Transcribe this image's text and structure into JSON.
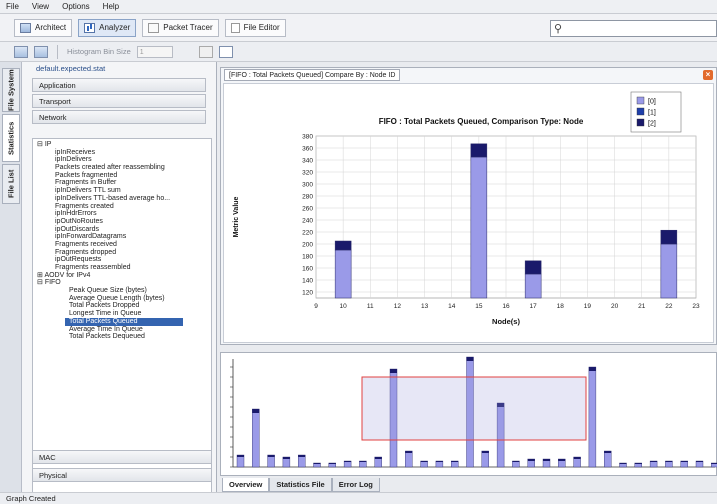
{
  "menu": [
    "File",
    "View",
    "Options",
    "Help"
  ],
  "toolbar": {
    "architect": "Architect",
    "analyzer": "Analyzer",
    "packet_tracer": "Packet Tracer",
    "file_editor": "File Editor"
  },
  "toolbar2": {
    "histogram_label": "Histogram Bin Size",
    "histogram_value": "1"
  },
  "vtabs": [
    "File System",
    "Statistics",
    "File List"
  ],
  "left": {
    "file_name": "default.expected.stat",
    "categories_top": [
      "Application",
      "Transport",
      "Network"
    ],
    "categories_bottom": [
      "MAC",
      "Physical"
    ],
    "tree": [
      {
        "text": "IP",
        "level": 0,
        "toggle": "⊟"
      },
      {
        "text": "ipInReceives",
        "level": 1
      },
      {
        "text": "ipInDelivers",
        "level": 1
      },
      {
        "text": "Packets created after reassembling",
        "level": 1
      },
      {
        "text": "Packets fragmented",
        "level": 1
      },
      {
        "text": "Fragments in Buffer",
        "level": 1
      },
      {
        "text": "ipInDelivers TTL sum",
        "level": 1
      },
      {
        "text": "ipInDelivers TTL-based average ho...",
        "level": 1
      },
      {
        "text": "Fragments created",
        "level": 1
      },
      {
        "text": "ipInHdrErrors",
        "level": 1
      },
      {
        "text": "ipOutNoRoutes",
        "level": 1
      },
      {
        "text": "ipOutDiscards",
        "level": 1
      },
      {
        "text": "ipInForwardDatagrams",
        "level": 1
      },
      {
        "text": "Fragments received",
        "level": 1
      },
      {
        "text": "Fragments dropped",
        "level": 1
      },
      {
        "text": "ipOutRequests",
        "level": 1
      },
      {
        "text": "Fragments reassembled",
        "level": 1
      },
      {
        "text": "AODV for IPv4",
        "level": 0,
        "toggle": "⊞"
      },
      {
        "text": "FIFO",
        "level": 0,
        "toggle": "⊟"
      },
      {
        "text": "Peak Queue Size (bytes)",
        "level": 2
      },
      {
        "text": "Average Queue Length (bytes)",
        "level": 2
      },
      {
        "text": "Total Packets Dropped",
        "level": 2
      },
      {
        "text": "Longest Time in Queue",
        "level": 2
      },
      {
        "text": "Total Packets Queued",
        "level": 2,
        "selected": true
      },
      {
        "text": "Average Time In Queue",
        "level": 2
      },
      {
        "text": "Total Packets Dequeued",
        "level": 2
      }
    ]
  },
  "chart_panel": {
    "tab_title": "[FIFO : Total Packets Queued] Compare By : Node ID"
  },
  "chart_data": {
    "type": "bar",
    "title": "FIFO : Total Packets Queued, Comparison Type: Node",
    "xlabel": "Node(s)",
    "ylabel": "Metric Value",
    "x_ticks": [
      9,
      10,
      11,
      12,
      13,
      14,
      15,
      16,
      17,
      18,
      19,
      20,
      21,
      22,
      23
    ],
    "y_ticks": [
      120,
      140,
      160,
      180,
      200,
      220,
      240,
      260,
      280,
      300,
      320,
      340,
      360,
      380
    ],
    "ylim": [
      110,
      380
    ],
    "xlim": [
      9,
      23
    ],
    "stacked": true,
    "categories": [
      10,
      15,
      17,
      22
    ],
    "series": [
      {
        "name": "[0]",
        "color": "#9a9ae8",
        "values": [
          190,
          345,
          150,
          200
        ]
      },
      {
        "name": "[1]",
        "color": "#1f3faa",
        "values": [
          0,
          0,
          0,
          0
        ]
      },
      {
        "name": "[2]",
        "color": "#1a1a6b",
        "values": [
          15,
          22,
          22,
          23
        ]
      }
    ],
    "legend_position": "top-right",
    "grid": true
  },
  "overview": {
    "bars": [
      12,
      58,
      12,
      10,
      12,
      4,
      4,
      6,
      6,
      10,
      98,
      16,
      6,
      6,
      6,
      110,
      16,
      64,
      6,
      8,
      8,
      8,
      10,
      100,
      16,
      4,
      4,
      6,
      6,
      6,
      6,
      4
    ],
    "caps": [
      2,
      4,
      2,
      2,
      2,
      1,
      1,
      1,
      1,
      2,
      4,
      2,
      1,
      1,
      1,
      4,
      2,
      4,
      1,
      2,
      2,
      2,
      2,
      4,
      2,
      1,
      1,
      1,
      1,
      1,
      1,
      1
    ]
  },
  "bottom_tabs": [
    "Overview",
    "Statistics File",
    "Error Log"
  ],
  "status": "Graph Created",
  "colors": {
    "accent": "#3464b0",
    "selection_box": "#e04040"
  }
}
